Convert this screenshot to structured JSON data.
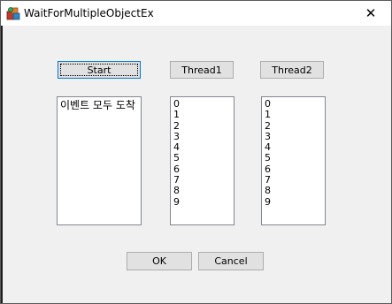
{
  "window": {
    "title": "WaitForMultipleObjectEx",
    "close_glyph": "✕"
  },
  "buttons": {
    "start": "Start",
    "thread1": "Thread1",
    "thread2": "Thread2",
    "ok": "OK",
    "cancel": "Cancel"
  },
  "lists": {
    "events": [
      "이벤트 모두 도착"
    ],
    "thread1": [
      "0",
      "1",
      "2",
      "3",
      "4",
      "5",
      "6",
      "7",
      "8",
      "9"
    ],
    "thread2": [
      "0",
      "1",
      "2",
      "3",
      "4",
      "5",
      "6",
      "7",
      "8",
      "9"
    ]
  },
  "colors": {
    "dialog_bg": "#f0f0f0",
    "button_bg": "#e1e1e1",
    "focus_border": "#0078d7"
  },
  "icons": {
    "app": "app-icon",
    "close": "close-icon"
  }
}
